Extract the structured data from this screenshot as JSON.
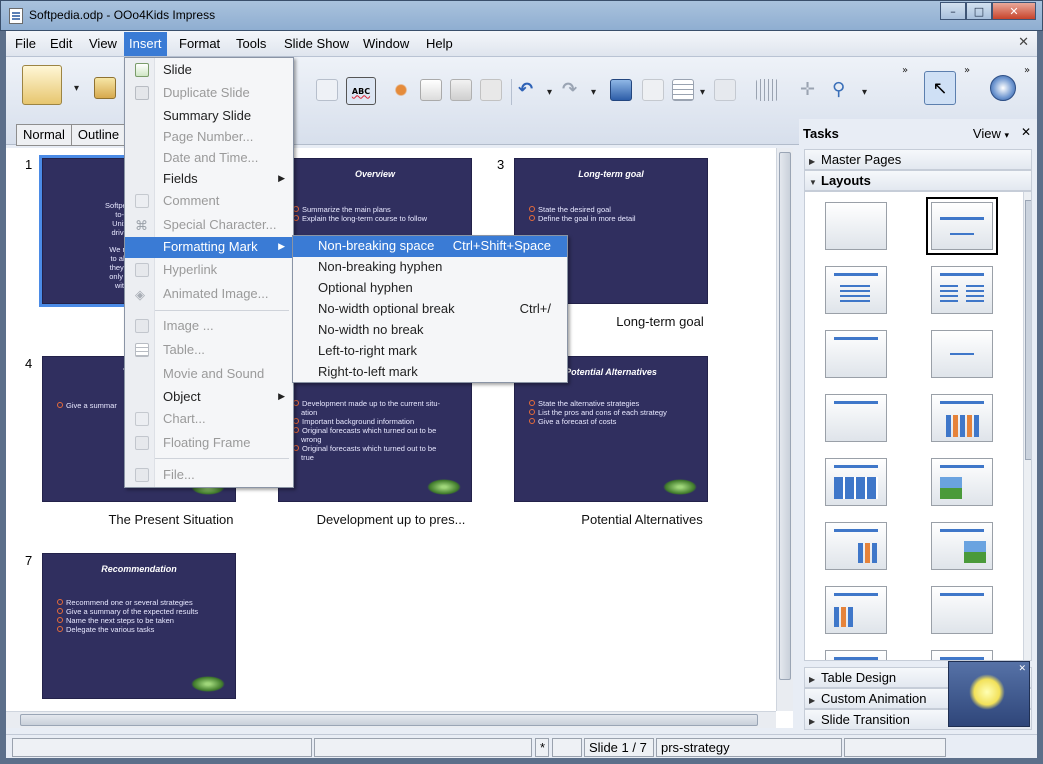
{
  "window": {
    "title": "Softpedia.odp - OOo4Kids Impress",
    "min": "–",
    "max": "□",
    "close": "✕"
  },
  "menubar": {
    "items": [
      "File",
      "Edit",
      "View",
      "Insert",
      "Format",
      "Tools",
      "Slide Show",
      "Window",
      "Help"
    ],
    "doc_close": "✕"
  },
  "view_tabs": [
    "Normal",
    "Outline",
    "N"
  ],
  "slides": [
    {
      "num": "1",
      "title": "Soft",
      "body": [
        "Softpedia is a library",
        "to-try software",
        "Unix/Linux, gam",
        "drivers, mobile d",
        "",
        "We review and ca",
        "to allow the visito",
        "they and their sys",
        "only the best prod",
        "with self-made"
      ],
      "caption": ""
    },
    {
      "num": "",
      "title": "Overview",
      "body": [
        "Summarize the main plans",
        "Explain the long-term course to follow"
      ],
      "caption": ""
    },
    {
      "num": "3",
      "title": "Long-term goal",
      "body": [
        "State the desired goal",
        "Define the goal in more detail"
      ],
      "caption": "Long-term goal"
    },
    {
      "num": "4",
      "title": "The Pre",
      "body": [
        "Give a summar"
      ],
      "caption": "The Present Situation"
    },
    {
      "num": "",
      "title": "",
      "body": [
        "Development made up to the current situ-",
        "ation",
        "Important background information",
        "Original forecasts which turned out to be",
        "wrong",
        "Original forecasts which turned out to be",
        "true"
      ],
      "caption": "Development up to pres..."
    },
    {
      "num": "",
      "title": "Potential Alternatives",
      "body": [
        "State the alternative strategies",
        "List the pros and cons of each strategy",
        "Give a forecast of costs"
      ],
      "caption": "Potential Alternatives"
    },
    {
      "num": "7",
      "title": "Recommendation",
      "body": [
        "Recommend one or several strategies",
        "Give a summary of the expected results",
        "Name the next steps to be taken",
        "Delegate the various tasks"
      ],
      "caption": ""
    }
  ],
  "tasks": {
    "title": "Tasks",
    "view": "View",
    "view_arrow": "▾",
    "close": "✕",
    "sections": [
      "Master Pages",
      "Layouts",
      "Table Design",
      "Custom Animation",
      "Slide Transition"
    ]
  },
  "status": {
    "star": "*",
    "slide": "Slide 1 / 7",
    "master": "prs-strategy"
  },
  "insert_menu": {
    "items": [
      {
        "label": "Slide",
        "disabled": false
      },
      {
        "label": "Duplicate Slide",
        "disabled": true
      },
      {
        "label": "Summary Slide",
        "disabled": false
      },
      {
        "label": "Page Number...",
        "disabled": true
      },
      {
        "label": "Date and Time...",
        "disabled": true
      },
      {
        "label": "Fields",
        "disabled": false
      },
      {
        "label": "Comment",
        "disabled": true
      },
      {
        "label": "Special Character...",
        "disabled": true
      },
      {
        "label": "Formatting Mark",
        "disabled": false
      },
      {
        "label": "Hyperlink",
        "disabled": true
      },
      {
        "label": "Animated Image...",
        "disabled": true
      },
      {
        "label": "Image ...",
        "disabled": true
      },
      {
        "label": "Table...",
        "disabled": true
      },
      {
        "label": "Movie and Sound",
        "disabled": true
      },
      {
        "label": "Object",
        "disabled": false
      },
      {
        "label": "Chart...",
        "disabled": true
      },
      {
        "label": "Floating Frame",
        "disabled": true
      },
      {
        "label": "File...",
        "disabled": true
      }
    ],
    "submenu_arrow": "▶"
  },
  "formatting_submenu": [
    {
      "label": "Non-breaking space",
      "accel": "Ctrl+Shift+Space"
    },
    {
      "label": "Non-breaking hyphen",
      "accel": ""
    },
    {
      "label": "Optional hyphen",
      "accel": ""
    },
    {
      "label": "No-width optional break",
      "accel": "Ctrl+/"
    },
    {
      "label": "No-width no break",
      "accel": ""
    },
    {
      "label": "Left-to-right mark",
      "accel": ""
    },
    {
      "label": "Right-to-left mark",
      "accel": ""
    }
  ]
}
